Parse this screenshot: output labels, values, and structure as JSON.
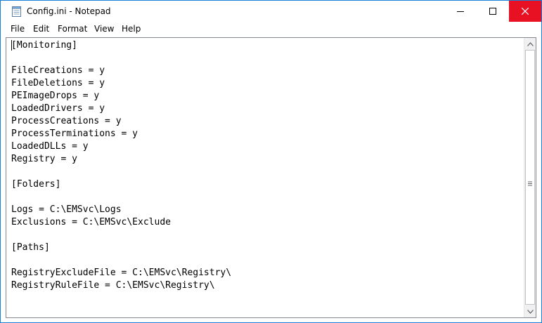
{
  "window": {
    "title": "Config.ini - Notepad",
    "accent_color": "#1a7fd6",
    "close_hover_color": "#e81123",
    "icons": {
      "app": "notepad-icon",
      "minimize": "minimize-icon",
      "maximize": "maximize-icon",
      "close": "close-icon"
    }
  },
  "menubar": {
    "items": [
      "File",
      "Edit",
      "Format",
      "View",
      "Help"
    ]
  },
  "editor": {
    "lines": [
      "[Monitoring]",
      "",
      "FileCreations = y",
      "FileDeletions = y",
      "PEImageDrops = y",
      "LoadedDrivers = y",
      "ProcessCreations = y",
      "ProcessTerminations = y",
      "LoadedDLLs = y",
      "Registry = y",
      "",
      "[Folders]",
      "",
      "Logs = C:\\EMSvc\\Logs",
      "Exclusions = C:\\EMSvc\\Exclude",
      "",
      "[Paths]",
      "",
      "RegistryExcludeFile = C:\\EMSvc\\Registry\\",
      "RegistryRuleFile = C:\\EMSvc\\Registry\\"
    ]
  }
}
